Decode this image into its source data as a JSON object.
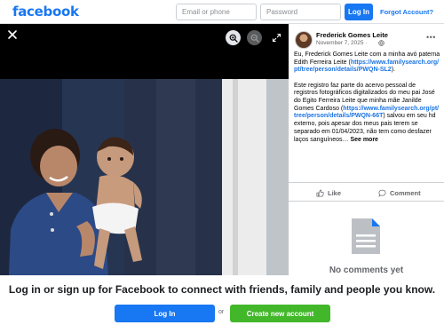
{
  "header": {
    "logo": "facebook",
    "email_placeholder": "Email or phone",
    "password_placeholder": "Password",
    "login_label": "Log In",
    "forgot_label": "Forgot Account?"
  },
  "viewer": {
    "icons": [
      "close-icon",
      "zoom-in-icon",
      "zoom-out-icon",
      "expand-icon"
    ]
  },
  "post": {
    "author": "Frederick Gomes Leite",
    "date": "November 7, 2025 ·",
    "privacy_icon": "globe-icon",
    "caption_p1_text": "Eu, Frederick Gomes Leite com a minha avó paterna Edith Ferreira Leite (",
    "caption_p1_link": "https://www.familysearch.org/pt/tree/person/details/PWQN-SL2",
    "caption_p1_end": ").",
    "caption_p2_text": "Este registro faz parte do acervo pessoal de registros fotográficos digitalizados do meu pai José do Egito Ferreira Leite que minha mãe Janilde Gomes Cardoso (",
    "caption_p2_link": "https://www.familysearch.org/pt/tree/person/details/PWQN-66T",
    "caption_p2_end": ") salvou em seu hd externo, pois apesar dos meus pais terem se separado em 01/04/2023, não tem como desfazer laços sanguíneos…",
    "see_more": "See more",
    "like_label": "Like",
    "comment_label": "Comment",
    "no_comments": "No comments yet"
  },
  "footer": {
    "prompt": "Log in or sign up for Facebook to connect with friends, family and people you know.",
    "login_label": "Log In",
    "or_label": "or",
    "create_label": "Create new account"
  },
  "colors": {
    "brand": "#1877f2",
    "create_green": "#42b72a"
  }
}
